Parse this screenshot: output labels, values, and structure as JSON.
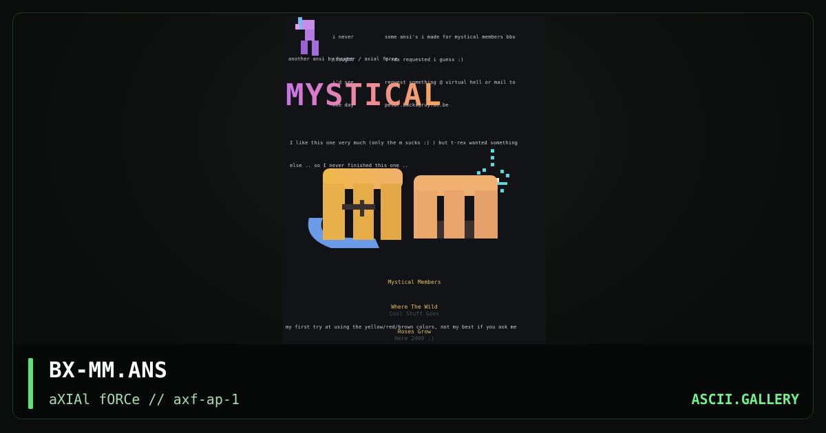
{
  "artwork": {
    "header_col1": [
      "i never",
      "thought",
      "i'd see",
      "the day"
    ],
    "header_col2": [
      "some ansi's i made for mystical members bbs",
      "t-rex requested i guess :)",
      "request something @ virtual hell or mail to",
      "peter.backs@ruy.ac.be"
    ],
    "credit": "another ansi by hexter / axial force",
    "logo_word": "MYSTICAL",
    "comment": [
      "I like this one very much (only the m sucks :) ) but t-rex wanted something",
      "else .. so I never finished this one .."
    ],
    "big_logo": "MM",
    "bbs_lines": [
      "Mystical Members",
      "Where The Wild",
      "Roses Grow"
    ],
    "dim_lines": [
      "Cool Stuff Goes",
      "Here 2000 :)"
    ],
    "footer": "my first try at using the yellow/red/brown colors, not my best if you ask me"
  },
  "info": {
    "title": "BX-MM.ANS",
    "subtitle": "aXIAl fORCe // axf-ap-1",
    "brand": "ASCII.GALLERY"
  },
  "colors": {
    "accent": "#5fe07a",
    "brand": "#72f08a",
    "background": "#0b0d0c"
  }
}
